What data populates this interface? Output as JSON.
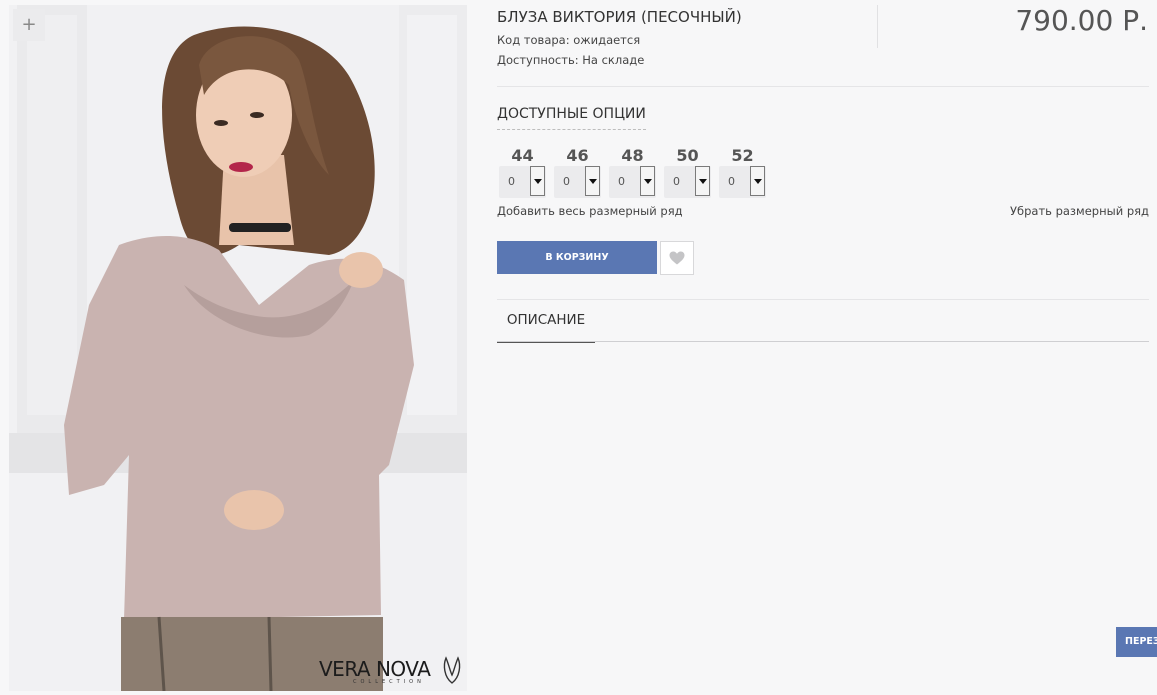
{
  "gallery": {
    "zoom_icon": "plus-icon",
    "zoom_symbol": "+",
    "brand_name": "VERA NOVA",
    "brand_subtitle": "COLLECTION"
  },
  "product": {
    "title": "БЛУЗА ВИКТОРИЯ (ПЕСОЧНЫЙ)",
    "code_line": "Код товара: ожидается",
    "stock_line": "Доступность: На складе",
    "price": "790.00 Р."
  },
  "options": {
    "heading": "ДОСТУПНЫЕ ОПЦИИ",
    "sizes": [
      {
        "size": "44",
        "qty": "0"
      },
      {
        "size": "46",
        "qty": "0"
      },
      {
        "size": "48",
        "qty": "0"
      },
      {
        "size": "50",
        "qty": "0"
      },
      {
        "size": "52",
        "qty": "0"
      }
    ],
    "add_all_label": "Добавить весь размерный ряд",
    "remove_label": "Убрать размерный ряд"
  },
  "actions": {
    "cart_label": "В КОРЗИНУ",
    "wishlist_icon": "heart-icon",
    "side_button_label": "ПЕРЕЗ"
  },
  "tabs": [
    {
      "label": "ОПИСАНИЕ",
      "active": true
    }
  ],
  "colors": {
    "accent": "#5a77b3",
    "background": "#f7f7f8"
  }
}
